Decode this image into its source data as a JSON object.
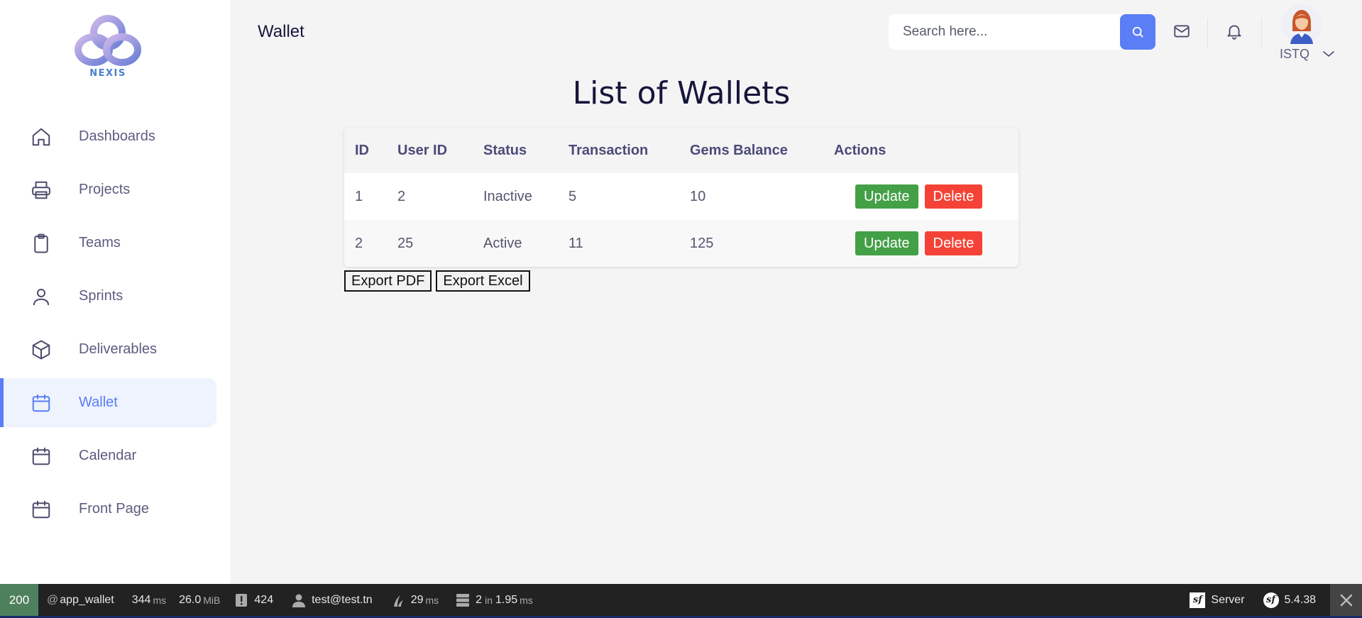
{
  "brand": {
    "logo_text": "NEXIS"
  },
  "sidebar": {
    "items": [
      {
        "label": "Dashboards",
        "icon": "home-icon",
        "active": false
      },
      {
        "label": "Projects",
        "icon": "printer-icon",
        "active": false
      },
      {
        "label": "Teams",
        "icon": "clipboard-icon",
        "active": false
      },
      {
        "label": "Sprints",
        "icon": "user-icon",
        "active": false
      },
      {
        "label": "Deliverables",
        "icon": "box-icon",
        "active": false
      },
      {
        "label": "Wallet",
        "icon": "calendar-icon",
        "active": true
      },
      {
        "label": "Calendar",
        "icon": "calendar-icon",
        "active": false
      },
      {
        "label": "Front Page",
        "icon": "calendar-icon",
        "active": false
      }
    ]
  },
  "header": {
    "title": "Wallet",
    "search_placeholder": "Search here...",
    "user_name": "ISTQ"
  },
  "main": {
    "title": "List of Wallets",
    "columns": [
      "ID",
      "User ID",
      "Status",
      "Transaction",
      "Gems Balance",
      "Actions"
    ],
    "rows": [
      {
        "id": "1",
        "user_id": "2",
        "status": "Inactive",
        "transaction": "5",
        "gems_balance": "10"
      },
      {
        "id": "2",
        "user_id": "25",
        "status": "Active",
        "transaction": "11",
        "gems_balance": "125"
      }
    ],
    "update_label": "Update",
    "delete_label": "Delete",
    "export_pdf_label": "Export PDF",
    "export_excel_label": "Export Excel"
  },
  "toolbar": {
    "status_code": "200",
    "route_prefix": "@",
    "route": "app_wallet",
    "time_value": "344",
    "time_unit": "ms",
    "memory_value": "26.0",
    "memory_unit": "MiB",
    "logs_count": "424",
    "user": "test@test.tn",
    "twig_value": "29",
    "twig_unit": "ms",
    "db_queries": "2",
    "db_in": "in",
    "db_time": "1.95",
    "db_unit": "ms",
    "server_label": "Server",
    "version": "5.4.38"
  },
  "colors": {
    "accent": "#5b7df5",
    "update": "#43a047",
    "delete": "#f44336",
    "status_ok": "#4f805d"
  }
}
